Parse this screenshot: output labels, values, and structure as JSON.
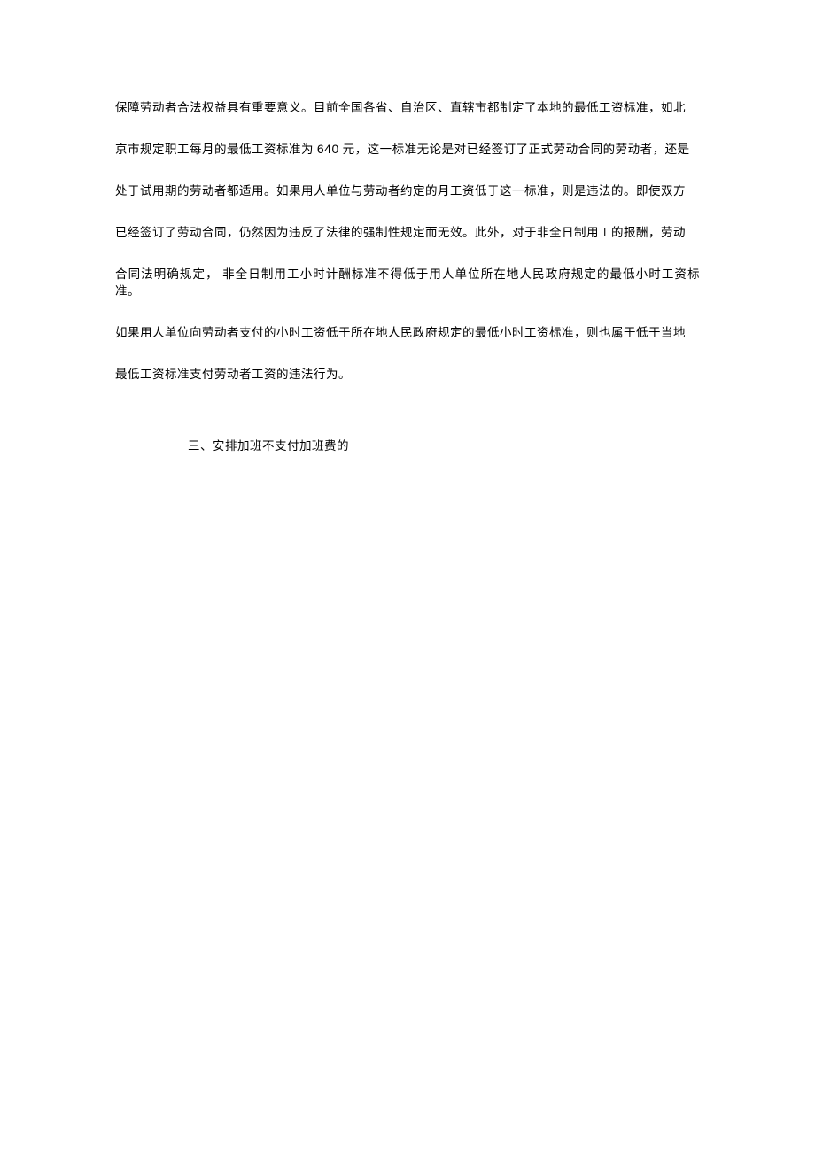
{
  "paragraphs": {
    "p1": "保障劳动者合法权益具有重要意义。目前全国各省、自治区、直辖市都制定了本地的最低工资标准，如北",
    "p2_pre": "京市规定职工每月的最低工资标准为 ",
    "p2_num": "640",
    "p2_post": " 元，这一标准无论是对已经签订了正式劳动合同的劳动者，还是",
    "p3": "处于试用期的劳动者都适用。如果用人单位与劳动者约定的月工资低于这一标准，则是违法的。即使双方",
    "p4": "已经签订了劳动合同，仍然因为违反了法律的强制性规定而无效。此外，对于非全日制用工的报酬，劳动",
    "p5": "合同法明确规定， 非全日制用工小时计酬标准不得低于用人单位所在地人民政府规定的最低小时工资标准。",
    "p6": "如果用人单位向劳动者支付的小时工资低于所在地人民政府规定的最低小时工资标准，则也属于低于当地",
    "p7": "最低工资标准支付劳动者工资的违法行为。"
  },
  "heading": "三、安排加班不支付加班费的"
}
